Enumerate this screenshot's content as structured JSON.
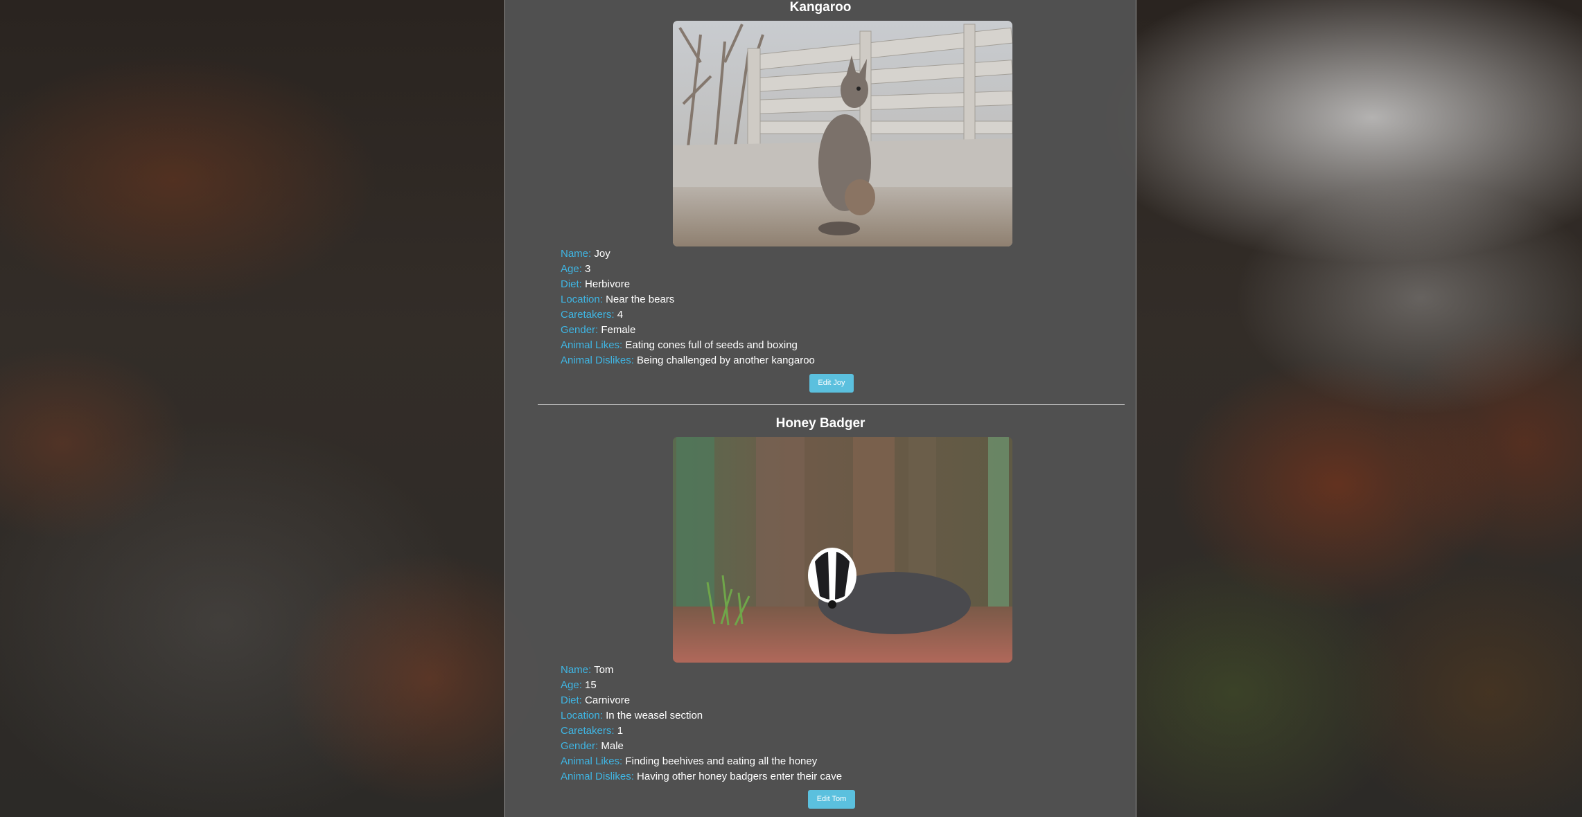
{
  "colors": {
    "label": "#3fb6e4",
    "value": "#ffffff",
    "button": "#5bc0de",
    "panel": "#525252"
  },
  "animals": [
    {
      "species": "Kangaroo",
      "photo_icon": "kangaroo-photo",
      "fields": [
        {
          "label": "Name:",
          "value": "Joy"
        },
        {
          "label": "Age:",
          "value": "3"
        },
        {
          "label": "Diet:",
          "value": "Herbivore"
        },
        {
          "label": "Location:",
          "value": "Near the bears"
        },
        {
          "label": "Caretakers:",
          "value": "4"
        },
        {
          "label": "Gender:",
          "value": "Female"
        },
        {
          "label": "Animal Likes:",
          "value": "Eating cones full of seeds and boxing"
        },
        {
          "label": "Animal Dislikes:",
          "value": "Being challenged by another kangaroo"
        }
      ],
      "edit_label": "Edit Joy"
    },
    {
      "species": "Honey Badger",
      "photo_icon": "badger-photo",
      "fields": [
        {
          "label": "Name:",
          "value": "Tom"
        },
        {
          "label": "Age:",
          "value": "15"
        },
        {
          "label": "Diet:",
          "value": "Carnivore"
        },
        {
          "label": "Location:",
          "value": "In the weasel section"
        },
        {
          "label": "Caretakers:",
          "value": "1"
        },
        {
          "label": "Gender:",
          "value": "Male"
        },
        {
          "label": "Animal Likes:",
          "value": "Finding beehives and eating all the honey"
        },
        {
          "label": "Animal Dislikes:",
          "value": "Having other honey badgers enter their cave"
        }
      ],
      "edit_label": "Edit Tom"
    }
  ]
}
